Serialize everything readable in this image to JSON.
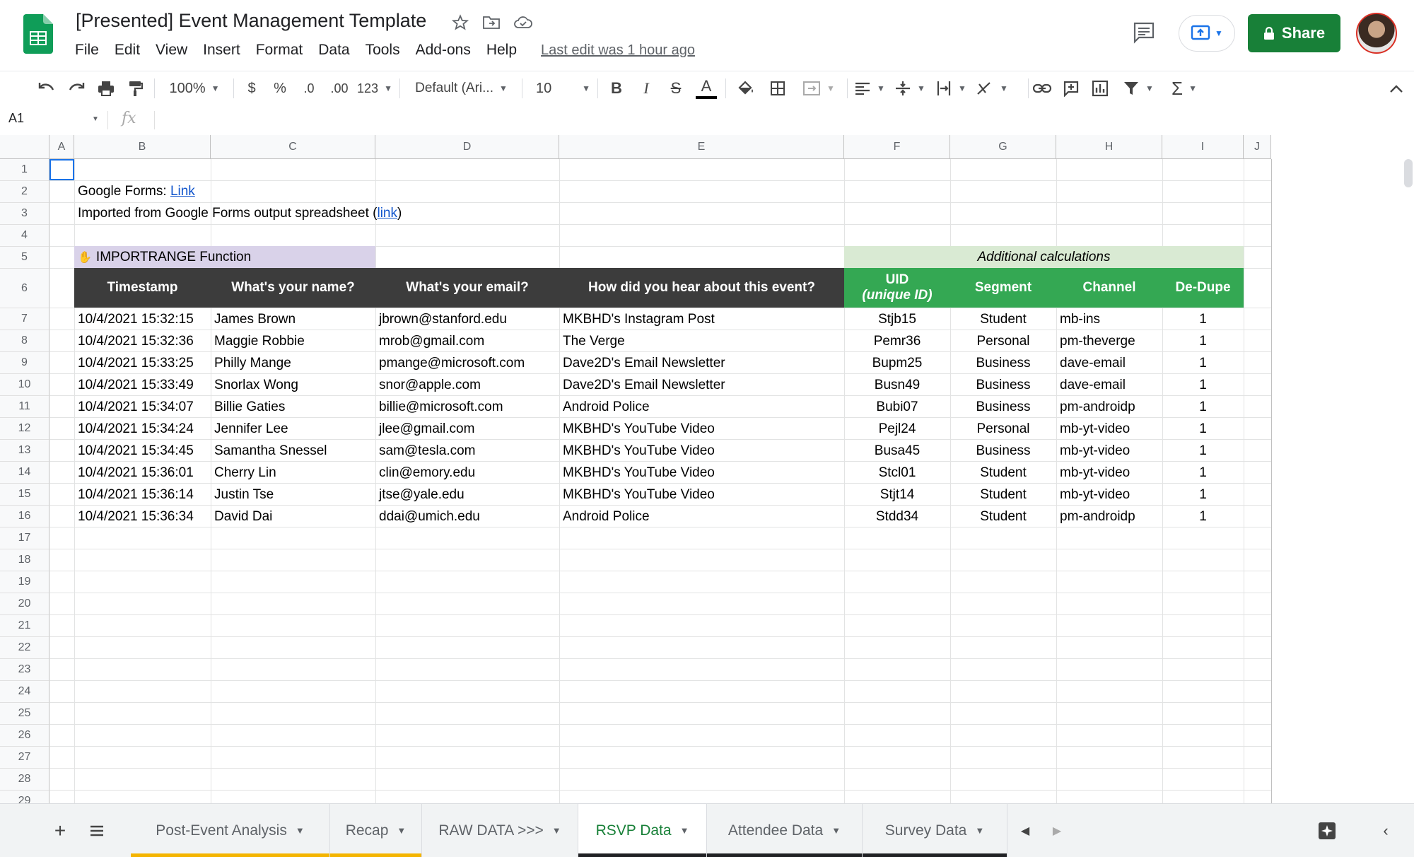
{
  "header": {
    "title": "[Presented] Event Management Template",
    "menu": [
      "File",
      "Edit",
      "View",
      "Insert",
      "Format",
      "Data",
      "Tools",
      "Add-ons",
      "Help"
    ],
    "last_edit": "Last edit was 1 hour ago",
    "share_label": "Share"
  },
  "toolbar": {
    "zoom": "100%",
    "currency": "$",
    "percent": "%",
    "dec_decrease": ".0",
    "dec_increase": ".00",
    "more_formats": "123",
    "font": "Default (Ari...",
    "font_size": "10",
    "bold": "B",
    "italic": "I",
    "strike": "S",
    "text_color": "A"
  },
  "formula_bar": {
    "cell_ref": "A1",
    "fx": "fx"
  },
  "grid": {
    "columns": [
      "A",
      "B",
      "C",
      "D",
      "E",
      "F",
      "G",
      "H",
      "I",
      "J"
    ],
    "rows": [
      "1",
      "2",
      "3",
      "4",
      "5",
      "6",
      "7",
      "8",
      "9",
      "10",
      "11",
      "12",
      "13",
      "14",
      "15",
      "16",
      "17",
      "18",
      "19",
      "20",
      "21",
      "22",
      "23",
      "24",
      "25",
      "26",
      "27",
      "28",
      "29"
    ],
    "row2_text": "Google Forms: ",
    "row2_link": "Link",
    "row3_text": "Imported from Google Forms output spreadsheet (",
    "row3_link": "link",
    "row3_close": ")",
    "row5_label": "IMPORTRANGE Function",
    "row5_calc": "Additional calculations",
    "headers": {
      "timestamp": "Timestamp",
      "name": "What's your name?",
      "email": "What's your email?",
      "source": "How did you hear about this event?",
      "uid": "UID",
      "uid_sub": "(unique ID)",
      "segment": "Segment",
      "channel": "Channel",
      "dedupe": "De-Dupe"
    },
    "data_rows": [
      [
        "10/4/2021 15:32:15",
        "James Brown",
        "jbrown@stanford.edu",
        "MKBHD's Instagram Post",
        "Stjb15",
        "Student",
        "mb-ins",
        "1"
      ],
      [
        "10/4/2021 15:32:36",
        "Maggie Robbie",
        "mrob@gmail.com",
        "The Verge",
        "Pemr36",
        "Personal",
        "pm-theverge",
        "1"
      ],
      [
        "10/4/2021 15:33:25",
        "Philly Mange",
        "pmange@microsoft.com",
        "Dave2D's Email Newsletter",
        "Bupm25",
        "Business",
        "dave-email",
        "1"
      ],
      [
        "10/4/2021 15:33:49",
        "Snorlax Wong",
        "snor@apple.com",
        "Dave2D's Email Newsletter",
        "Busn49",
        "Business",
        "dave-email",
        "1"
      ],
      [
        "10/4/2021 15:34:07",
        "Billie Gaties",
        "billie@microsoft.com",
        "Android Police",
        "Bubi07",
        "Business",
        "pm-androidp",
        "1"
      ],
      [
        "10/4/2021 15:34:24",
        "Jennifer Lee",
        "jlee@gmail.com",
        "MKBHD's YouTube Video",
        "Pejl24",
        "Personal",
        "mb-yt-video",
        "1"
      ],
      [
        "10/4/2021 15:34:45",
        "Samantha Snessel",
        "sam@tesla.com",
        "MKBHD's YouTube Video",
        "Busa45",
        "Business",
        "mb-yt-video",
        "1"
      ],
      [
        "10/4/2021 15:36:01",
        "Cherry Lin",
        "clin@emory.edu",
        "MKBHD's YouTube Video",
        "Stcl01",
        "Student",
        "mb-yt-video",
        "1"
      ],
      [
        "10/4/2021 15:36:14",
        "Justin Tse",
        "jtse@yale.edu",
        "MKBHD's YouTube Video",
        "Stjt14",
        "Student",
        "mb-yt-video",
        "1"
      ],
      [
        "10/4/2021 15:36:34",
        "David Dai",
        "ddai@umich.edu",
        "Android Police",
        "Stdd34",
        "Student",
        "pm-androidp",
        "1"
      ]
    ]
  },
  "sheets": {
    "tabs": [
      {
        "label": "Post-Event Analysis",
        "underline": "#f4b400"
      },
      {
        "label": "Recap",
        "underline": "#f4b400"
      },
      {
        "label": "RAW DATA >>>",
        "underline": ""
      },
      {
        "label": "RSVP Data",
        "underline": "#202124",
        "active": true
      },
      {
        "label": "Attendee Data",
        "underline": "#202124"
      },
      {
        "label": "Survey Data",
        "underline": "#202124"
      }
    ]
  },
  "colors": {
    "brand_green": "#188038",
    "header_dark": "#3c3c3c",
    "header_green": "#34a853",
    "purple_band": "#d9d2e9",
    "green_band": "#d9ead3",
    "link_blue": "#1155cc"
  }
}
